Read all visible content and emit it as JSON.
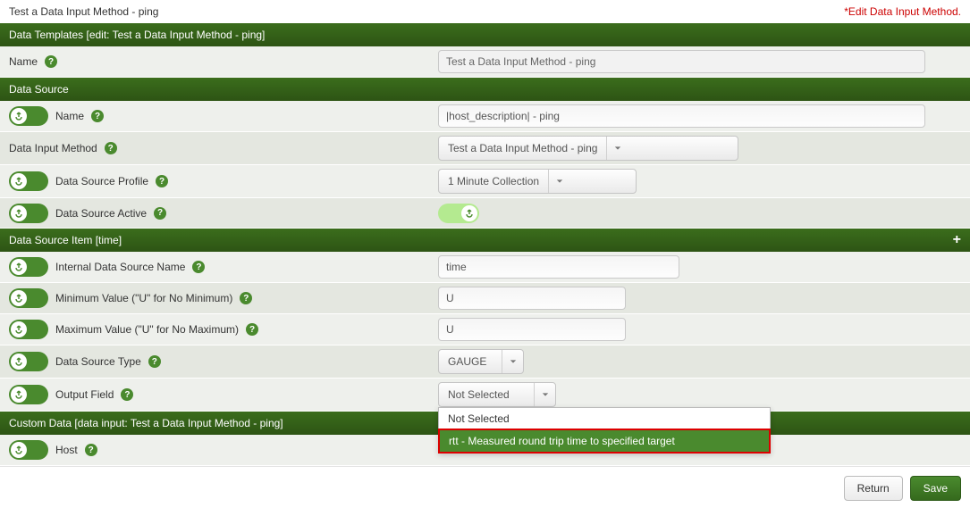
{
  "header": {
    "title": "Test a Data Input Method - ping",
    "edit_link": "*Edit Data Input Method."
  },
  "sections": {
    "data_templates": {
      "title": "Data Templates [edit: Test a Data Input Method - ping]"
    },
    "data_source": {
      "title": "Data Source"
    },
    "data_source_item": {
      "title": "Data Source Item [time]"
    },
    "custom_data": {
      "title": "Custom Data [data input: Test a Data Input Method - ping]"
    }
  },
  "fields": {
    "name_label": "Name",
    "name_value": "Test a Data Input Method - ping",
    "ds_name_label": "Name",
    "ds_name_value": "|host_description| - ping",
    "dim_label": "Data Input Method",
    "dim_value": "Test a Data Input Method - ping",
    "dsp_label": "Data Source Profile",
    "dsp_value": "1 Minute Collection",
    "dsa_label": "Data Source Active",
    "idsn_label": "Internal Data Source Name",
    "idsn_value": "time",
    "minv_label": "Minimum Value (\"U\" for No Minimum)",
    "minv_value": "U",
    "maxv_label": "Maximum Value (\"U\" for No Maximum)",
    "maxv_value": "U",
    "dst_label": "Data Source Type",
    "dst_value": "GAUGE",
    "of_label": "Output Field",
    "of_value": "Not Selected",
    "of_options": [
      "Not Selected",
      "rtt - Measured round trip time to specified target"
    ],
    "host_label": "Host",
    "host_value": ""
  },
  "buttons": {
    "return": "Return",
    "save": "Save"
  }
}
